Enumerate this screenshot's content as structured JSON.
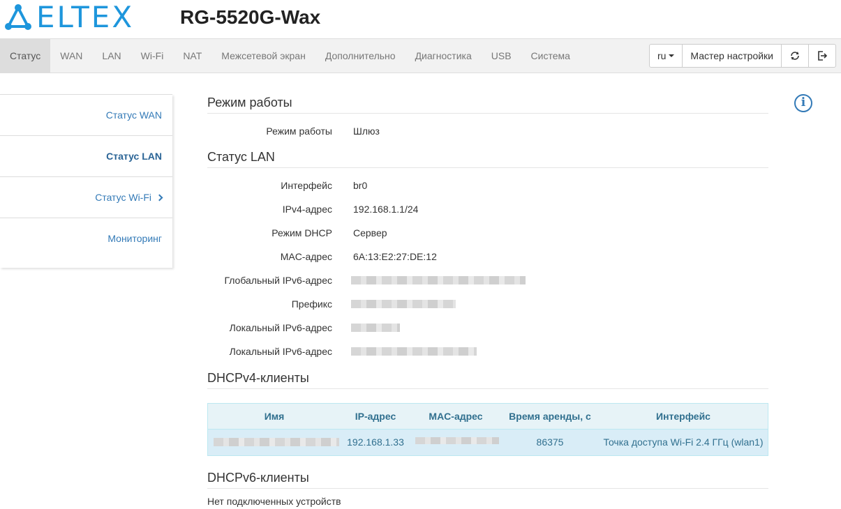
{
  "brand": {
    "logo_text": "ELTEX",
    "accent": "#1e96dc"
  },
  "device_title": "RG-5520G-Wax",
  "nav": {
    "tabs": [
      "Статус",
      "WAN",
      "LAN",
      "Wi-Fi",
      "NAT",
      "Межсетевой экран",
      "Дополнительно",
      "Диагностика",
      "USB",
      "Система"
    ],
    "active_tab": "Статус",
    "lang": "ru",
    "wizard": "Мастер настройки",
    "refresh_icon": "refresh-icon",
    "logout_icon": "logout-icon"
  },
  "sidebar": {
    "items": [
      {
        "label": "Статус WAN"
      },
      {
        "label": "Статус LAN"
      },
      {
        "label": "Статус Wi-Fi"
      },
      {
        "label": "Мониторинг"
      }
    ],
    "active": "Статус LAN"
  },
  "mode_section": {
    "title": "Режим работы",
    "label": "Режим работы",
    "value": "Шлюз"
  },
  "lan_section": {
    "title": "Статус LAN",
    "rows": [
      {
        "label": "Интерфейс",
        "value": "br0"
      },
      {
        "label": "IPv4-адрес",
        "value": "192.168.1.1/24"
      },
      {
        "label": "Режим DHCP",
        "value": "Сервер"
      },
      {
        "label": "MAC-адрес",
        "value": "6A:13:E2:27:DE:12"
      },
      {
        "label": "Глобальный IPv6-адрес",
        "value": ""
      },
      {
        "label": "Префикс",
        "value": ""
      },
      {
        "label": "Локальный IPv6-адрес",
        "value": ""
      },
      {
        "label": "Локальный IPv6-адрес",
        "value": ""
      }
    ]
  },
  "dhcpv4": {
    "title": "DHCPv4-клиенты",
    "columns": [
      "Имя",
      "IP-адрес",
      "MAC-адрес",
      "Время аренды, с",
      "Интерфейс"
    ],
    "rows": [
      {
        "name": "",
        "ip": "192.168.1.33",
        "mac": "",
        "lease": "86375",
        "iface": "Точка доступа Wi-Fi 2.4 ГГц (wlan1)"
      }
    ]
  },
  "dhcpv6": {
    "title": "DHCPv6-клиенты",
    "empty": "Нет подключенных устройств"
  }
}
